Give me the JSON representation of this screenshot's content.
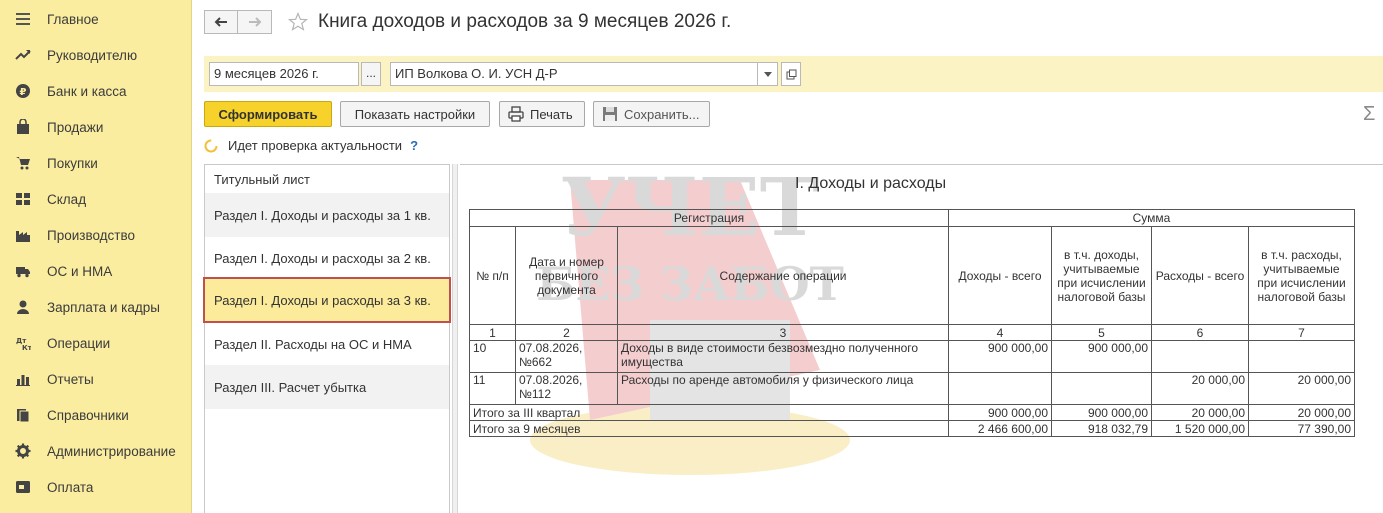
{
  "sidebar": {
    "items": [
      {
        "label": "Главное",
        "icon": "menu-icon"
      },
      {
        "label": "Руководителю",
        "icon": "trend-icon"
      },
      {
        "label": "Банк и касса",
        "icon": "ruble-icon"
      },
      {
        "label": "Продажи",
        "icon": "bag-icon"
      },
      {
        "label": "Покупки",
        "icon": "cart-icon"
      },
      {
        "label": "Склад",
        "icon": "warehouse-icon"
      },
      {
        "label": "Производство",
        "icon": "factory-icon"
      },
      {
        "label": "ОС и НМА",
        "icon": "truck-icon"
      },
      {
        "label": "Зарплата и кадры",
        "icon": "person-icon"
      },
      {
        "label": "Операции",
        "icon": "dt-kt-icon"
      },
      {
        "label": "Отчеты",
        "icon": "bar-chart-icon"
      },
      {
        "label": "Справочники",
        "icon": "books-icon"
      },
      {
        "label": "Администрирование",
        "icon": "gear-icon"
      },
      {
        "label": "Оплата",
        "icon": "payment-icon"
      }
    ]
  },
  "header": {
    "title": "Книга доходов и расходов за 9 месяцев 2026 г."
  },
  "params": {
    "period": "9 месяцев 2026 г.",
    "period_button": "...",
    "organization": "ИП Волкова О. И. УСН Д-Р"
  },
  "toolbar": {
    "generate": "Сформировать",
    "show_settings": "Показать настройки",
    "print": "Печать",
    "save": "Сохранить...",
    "sigma": "Σ"
  },
  "status": {
    "text": "Идет проверка актуальности",
    "help": "?"
  },
  "sections": {
    "items": [
      "Титульный лист",
      "Раздел I. Доходы и расходы за 1 кв.",
      "Раздел I. Доходы и расходы за 2 кв.",
      "Раздел I. Доходы и расходы за 3 кв.",
      "Раздел II. Расходы на ОС и НМА",
      "Раздел III. Расчет убытка"
    ],
    "active_index": 3
  },
  "report": {
    "title": "I. Доходы и расходы",
    "header": {
      "registration": "Регистрация",
      "sum": "Сумма",
      "num": "№ п/п",
      "date_doc": "Дата и номер первичного документа",
      "content": "Содержание операции",
      "income_total": "Доходы - всего",
      "income_tax": "в т.ч. доходы, учитываемые при исчислении налоговой базы",
      "expense_total": "Расходы - всего",
      "expense_tax": "в т.ч. расходы, учитываемые при исчислении налоговой базы"
    },
    "col_numbers": [
      "1",
      "2",
      "3",
      "4",
      "5",
      "6",
      "7"
    ],
    "rows": [
      {
        "num": "10",
        "date_doc": "07.08.2026, №662",
        "content": "Доходы в виде стоимости безвозмездно полученного имущества",
        "income_total": "900 000,00",
        "income_tax": "900 000,00",
        "expense_total": "",
        "expense_tax": ""
      },
      {
        "num": "11",
        "date_doc": "07.08.2026, №112",
        "content": "Расходы по аренде автомобиля у физического лица",
        "income_total": "",
        "income_tax": "",
        "expense_total": "20 000,00",
        "expense_tax": "20 000,00"
      }
    ],
    "totals": [
      {
        "label": "Итого за III квартал",
        "income_total": "900 000,00",
        "income_tax": "900 000,00",
        "expense_total": "20 000,00",
        "expense_tax": "20 000,00"
      },
      {
        "label": "Итого за 9 месяцев",
        "income_total": "2 466 600,00",
        "income_tax": "918 032,79",
        "expense_total": "1 520 000,00",
        "expense_tax": "77 390,00"
      }
    ]
  },
  "watermark": {
    "line1": "УЧЕТ",
    "line2": "БЕЗ ЗАБОТ"
  },
  "colors": {
    "sidebar_bg": "#fbeda0",
    "primary_button": "#f7d22a",
    "active_section_border": "#c0504d",
    "param_band": "#fbf3c4"
  }
}
